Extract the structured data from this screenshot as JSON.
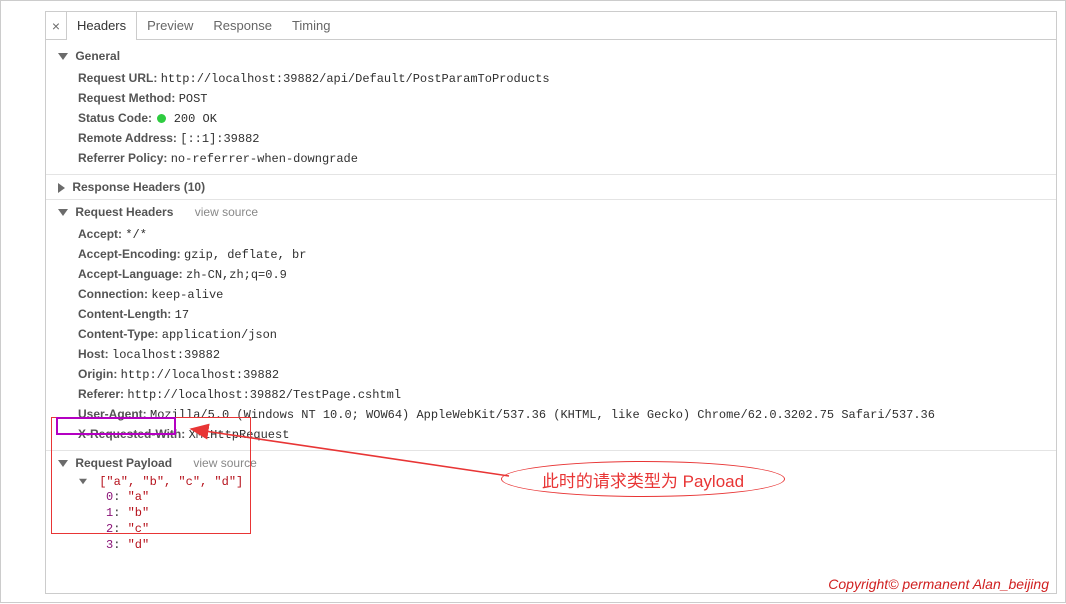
{
  "tabs": {
    "headers": "Headers",
    "preview": "Preview",
    "response": "Response",
    "timing": "Timing"
  },
  "sections": {
    "general": "General",
    "responseHeaders": "Response Headers (10)",
    "requestHeaders": "Request Headers",
    "requestPayload": "Request Payload",
    "viewSource": "view source"
  },
  "general": {
    "requestUrl": {
      "label": "Request URL:",
      "value": "http://localhost:39882/api/Default/PostParamToProducts"
    },
    "requestMethod": {
      "label": "Request Method:",
      "value": "POST"
    },
    "statusCode": {
      "label": "Status Code:",
      "value": "200 OK"
    },
    "remoteAddress": {
      "label": "Remote Address:",
      "value": "[::1]:39882"
    },
    "referrerPolicy": {
      "label": "Referrer Policy:",
      "value": "no-referrer-when-downgrade"
    }
  },
  "requestHeaders": {
    "accept": {
      "label": "Accept:",
      "value": "*/*"
    },
    "acceptEncoding": {
      "label": "Accept-Encoding:",
      "value": "gzip, deflate, br"
    },
    "acceptLanguage": {
      "label": "Accept-Language:",
      "value": "zh-CN,zh;q=0.9"
    },
    "connection": {
      "label": "Connection:",
      "value": "keep-alive"
    },
    "contentLength": {
      "label": "Content-Length:",
      "value": "17"
    },
    "contentType": {
      "label": "Content-Type:",
      "value": "application/json"
    },
    "host": {
      "label": "Host:",
      "value": "localhost:39882"
    },
    "origin": {
      "label": "Origin:",
      "value": "http://localhost:39882"
    },
    "referer": {
      "label": "Referer:",
      "value": "http://localhost:39882/TestPage.cshtml"
    },
    "userAgent": {
      "label": "User-Agent:",
      "value": "Mozilla/5.0 (Windows NT 10.0; WOW64) AppleWebKit/537.36 (KHTML, like Gecko) Chrome/62.0.3202.75 Safari/537.36"
    },
    "xRequestedWith": {
      "label": "X-Requested-With:",
      "value": "XMLHttpRequest"
    }
  },
  "payload": {
    "summary": "[\"a\", \"b\", \"c\", \"d\"]",
    "items": [
      {
        "idx": "0",
        "val": "\"a\""
      },
      {
        "idx": "1",
        "val": "\"b\""
      },
      {
        "idx": "2",
        "val": "\"c\""
      },
      {
        "idx": "3",
        "val": "\"d\""
      }
    ]
  },
  "annotation": {
    "text": "此时的请求类型为 Payload"
  },
  "copyright": "Copyright© permanent  Alan_beijing"
}
